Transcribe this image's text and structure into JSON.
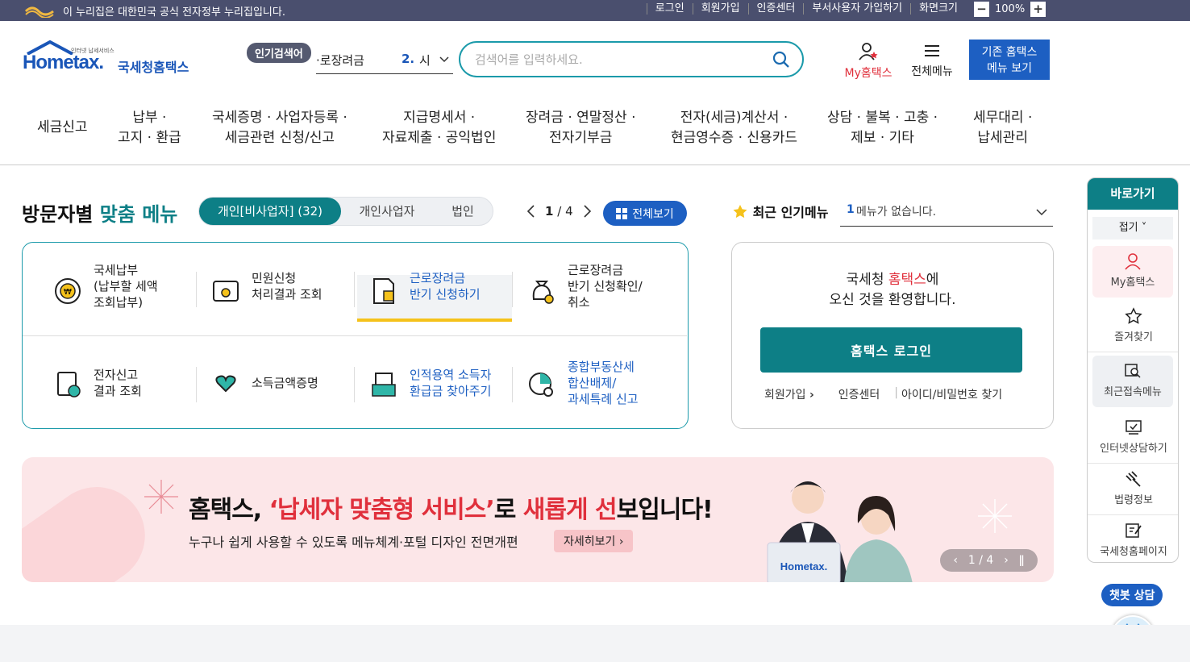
{
  "gov_bar": {
    "notice": "이 누리집은 대한민국 공식 전자정부 누리집입니다.",
    "links": [
      "로그인",
      "회원가입",
      "인증센터",
      "부서사용자 가입하기",
      "화면크기"
    ],
    "zoom": "100%",
    "zoom_minus": "−",
    "zoom_plus": "+"
  },
  "header": {
    "logo_text": "Hometax.",
    "logo_sub": "인터넷 납세서비스",
    "logo_kr": "국세청홈택스",
    "popular_badge": "인기검색어",
    "popular_term": "·로장려금",
    "popular_rank": "2.",
    "popular_rank_term": "시",
    "search_placeholder": "검색어를 입력하세요.",
    "my_hometax": "My홈택스",
    "all_menu": "전체메뉴",
    "old_menu_line1": "기존 홈택스",
    "old_menu_line2": "메뉴 보기"
  },
  "gnb": [
    "세금신고",
    "납부 ·\n고지 · 환급",
    "국세증명 · 사업자등록 ·\n세금관련 신청/신고",
    "지급명세서 ·\n자료제출 · 공익법인",
    "장려금 · 연말정산 ·\n전자기부금",
    "전자(세금)계산서 ·\n현금영수증 · 신용카드",
    "상담 · 불복 · 고충 ·\n제보 · 기타",
    "세무대리 ·\n납세관리"
  ],
  "custom_menu": {
    "title_a": "방문자별 ",
    "title_b": "맞춤 메뉴",
    "tabs": [
      "개인[비사업자] (32)",
      "개인사업자",
      "법인"
    ],
    "page_current": "1",
    "page_sep": "/",
    "page_total": "4",
    "view_all": "전체보기",
    "items": [
      "국세납부\n(납부할 세액\n조회납부)",
      "민원신청\n처리결과 조회",
      "근로장려금\n반기 신청하기",
      "근로장려금\n반기 신청확인/\n취소",
      "전자신고\n결과 조회",
      "소득금액증명",
      "인적용역 소득자\n환급금 찾아주기",
      "종합부동산세\n합산배제/\n과세특례 신고"
    ]
  },
  "recent": {
    "title": "최근 인기메뉴",
    "num": "1",
    "text": "메뉴가 없습니다."
  },
  "login": {
    "welcome_a": "국세청 ",
    "welcome_b": "홈택스",
    "welcome_c": "에",
    "welcome_line2": "오신 것을 환영합니다.",
    "login_btn": "홈택스 로그인",
    "join": "회원가입",
    "cert": "인증센터",
    "find": "아이디/비밀번호 찾기"
  },
  "banner": {
    "title_a": "홈택스, ",
    "title_b": "‘납세자 맞춤형 서비스’",
    "title_c": "로 ",
    "title_d": "새롭게 선",
    "title_e": "보입니다!",
    "subtitle": "누구나 쉽게 사용할 수 있도록 메뉴체계·포털 디자인 전면개편",
    "more": "자세히보기",
    "page": "1 / 4",
    "laptop_logo": "Hometax."
  },
  "quick": {
    "title": "바로가기",
    "fold": "접기",
    "items": [
      "My홈택스",
      "즐겨찾기",
      "최근접속메뉴",
      "인터넷상담하기",
      "법령정보",
      "국세청홈페이지"
    ]
  },
  "chatbot": "챗봇 상담",
  "colors": {
    "teal": "#0d7f86",
    "blue": "#1d5fc2",
    "red": "#e0303c",
    "gov_bar": "#4a4f6e"
  }
}
